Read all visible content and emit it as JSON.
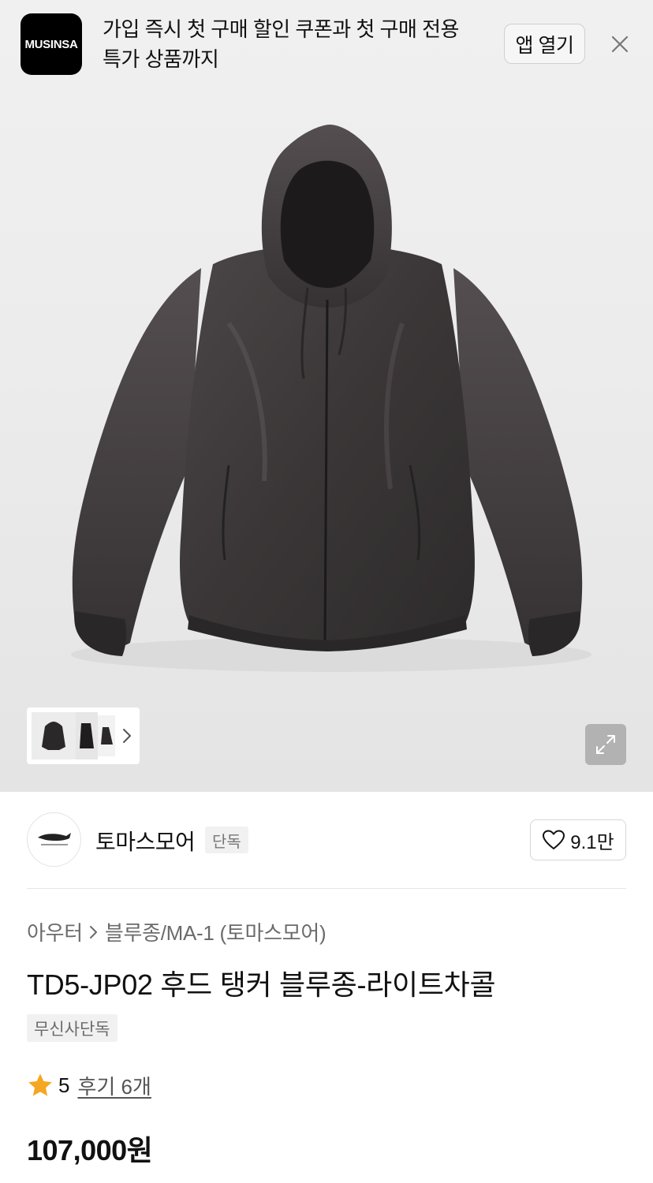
{
  "banner": {
    "logo_text": "MUSINSA",
    "message": "가입 즉시 첫 구매 할인 쿠폰과 첫 구매 전용 특가 상품까지",
    "open_app_label": "앱 열기",
    "close_icon": "close-icon"
  },
  "gallery": {
    "thumbnail_next_icon": "chevron-right-icon",
    "expand_icon": "expand-icon"
  },
  "brand": {
    "name": "토마스모어",
    "tag": "단독",
    "like_count": "9.1만",
    "like_icon": "heart-icon"
  },
  "product": {
    "breadcrumb": [
      "아우터",
      "블루종/MA-1 (토마스모어)"
    ],
    "title": "TD5-JP02 후드 탱커 블루종-라이트차콜",
    "badge": "무신사단독",
    "rating": "5",
    "review_link": "후기 6개",
    "price": "107,000원"
  },
  "colors": {
    "accent_star": "#F5A623",
    "text_primary": "#111111",
    "text_secondary": "#6B6B6B"
  }
}
